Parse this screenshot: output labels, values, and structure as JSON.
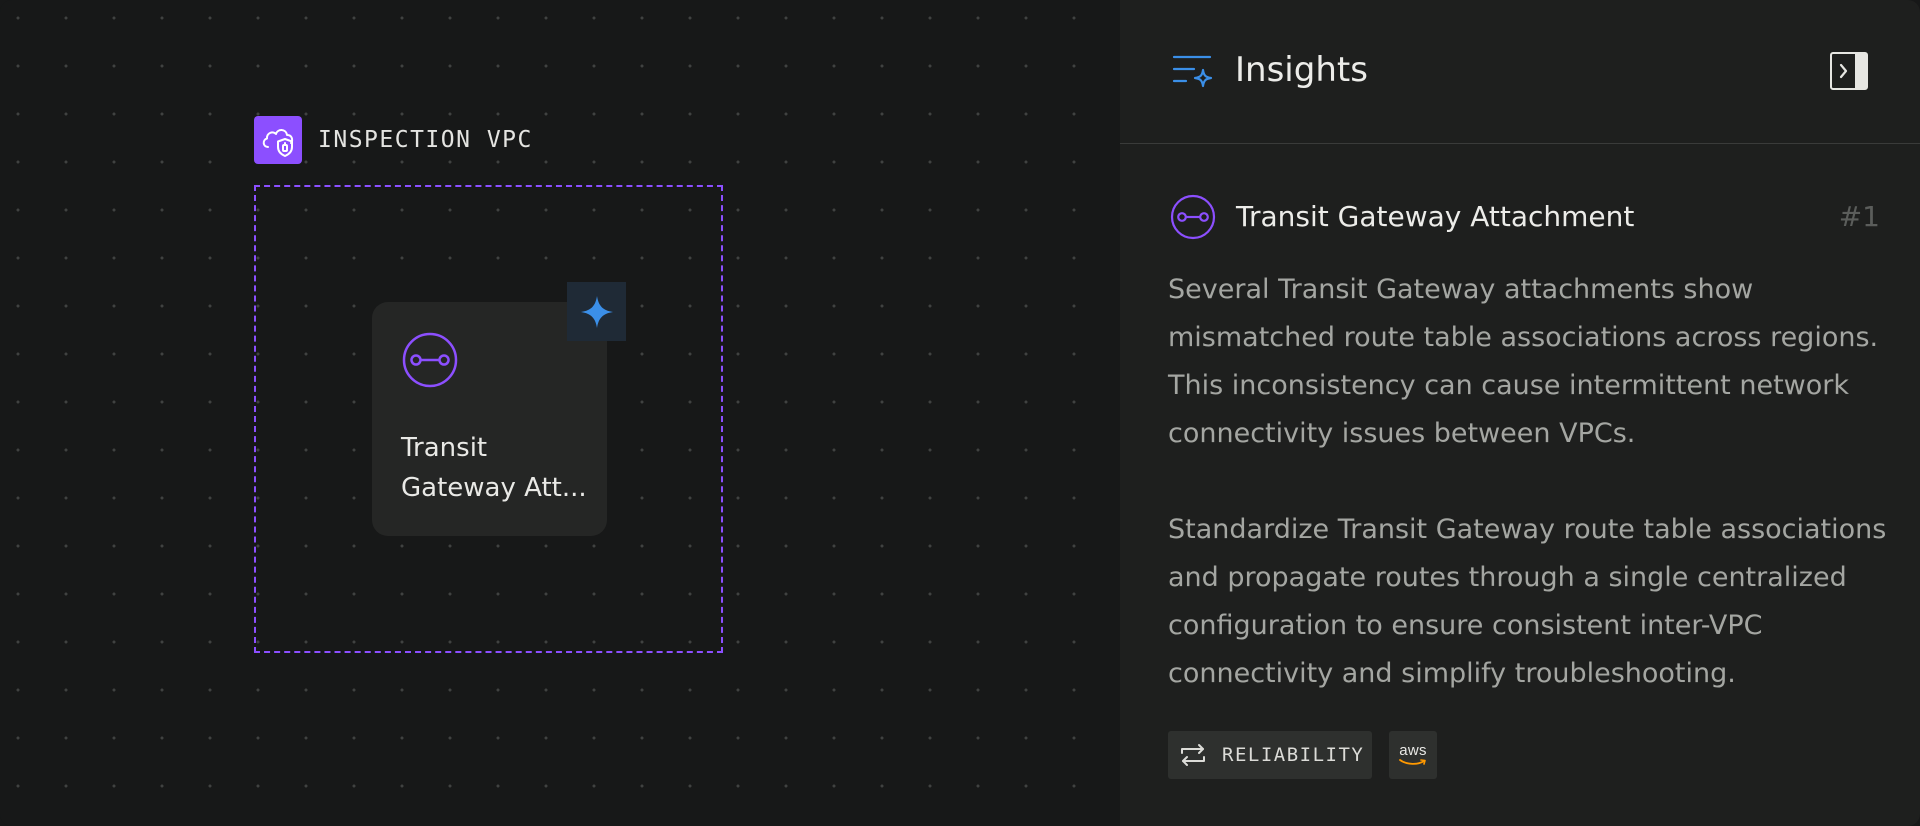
{
  "canvas": {
    "group": {
      "label": "INSPECTION VPC",
      "icon": "cloud-shield-icon",
      "accent": "#8C4FFF"
    },
    "node": {
      "label": "Transit Gateway Att...",
      "icon": "transit-gateway-icon",
      "badge_icon": "sparkle-icon",
      "badge_color": "#3B8FE8"
    }
  },
  "panel": {
    "title": "Insights",
    "title_icon": "insights-sparkle-icon",
    "collapse_icon": "panel-collapse-icon",
    "insight": {
      "title": "Transit Gateway Attachment",
      "number": "#1",
      "icon": "transit-gateway-icon",
      "description": "Several Transit Gateway attachments show mismatched route table associations across regions. This inconsistency can cause intermittent network connectivity issues between VPCs.",
      "recommendation": "Standardize Transit Gateway route table associations and propagate routes through a single centralized configuration to ensure consistent inter-VPC connectivity and simplify troubleshooting.",
      "tags": [
        {
          "label": "RELIABILITY",
          "icon": "reliability-arrows-icon"
        },
        {
          "label": "aws",
          "icon": "aws-logo"
        }
      ]
    }
  }
}
